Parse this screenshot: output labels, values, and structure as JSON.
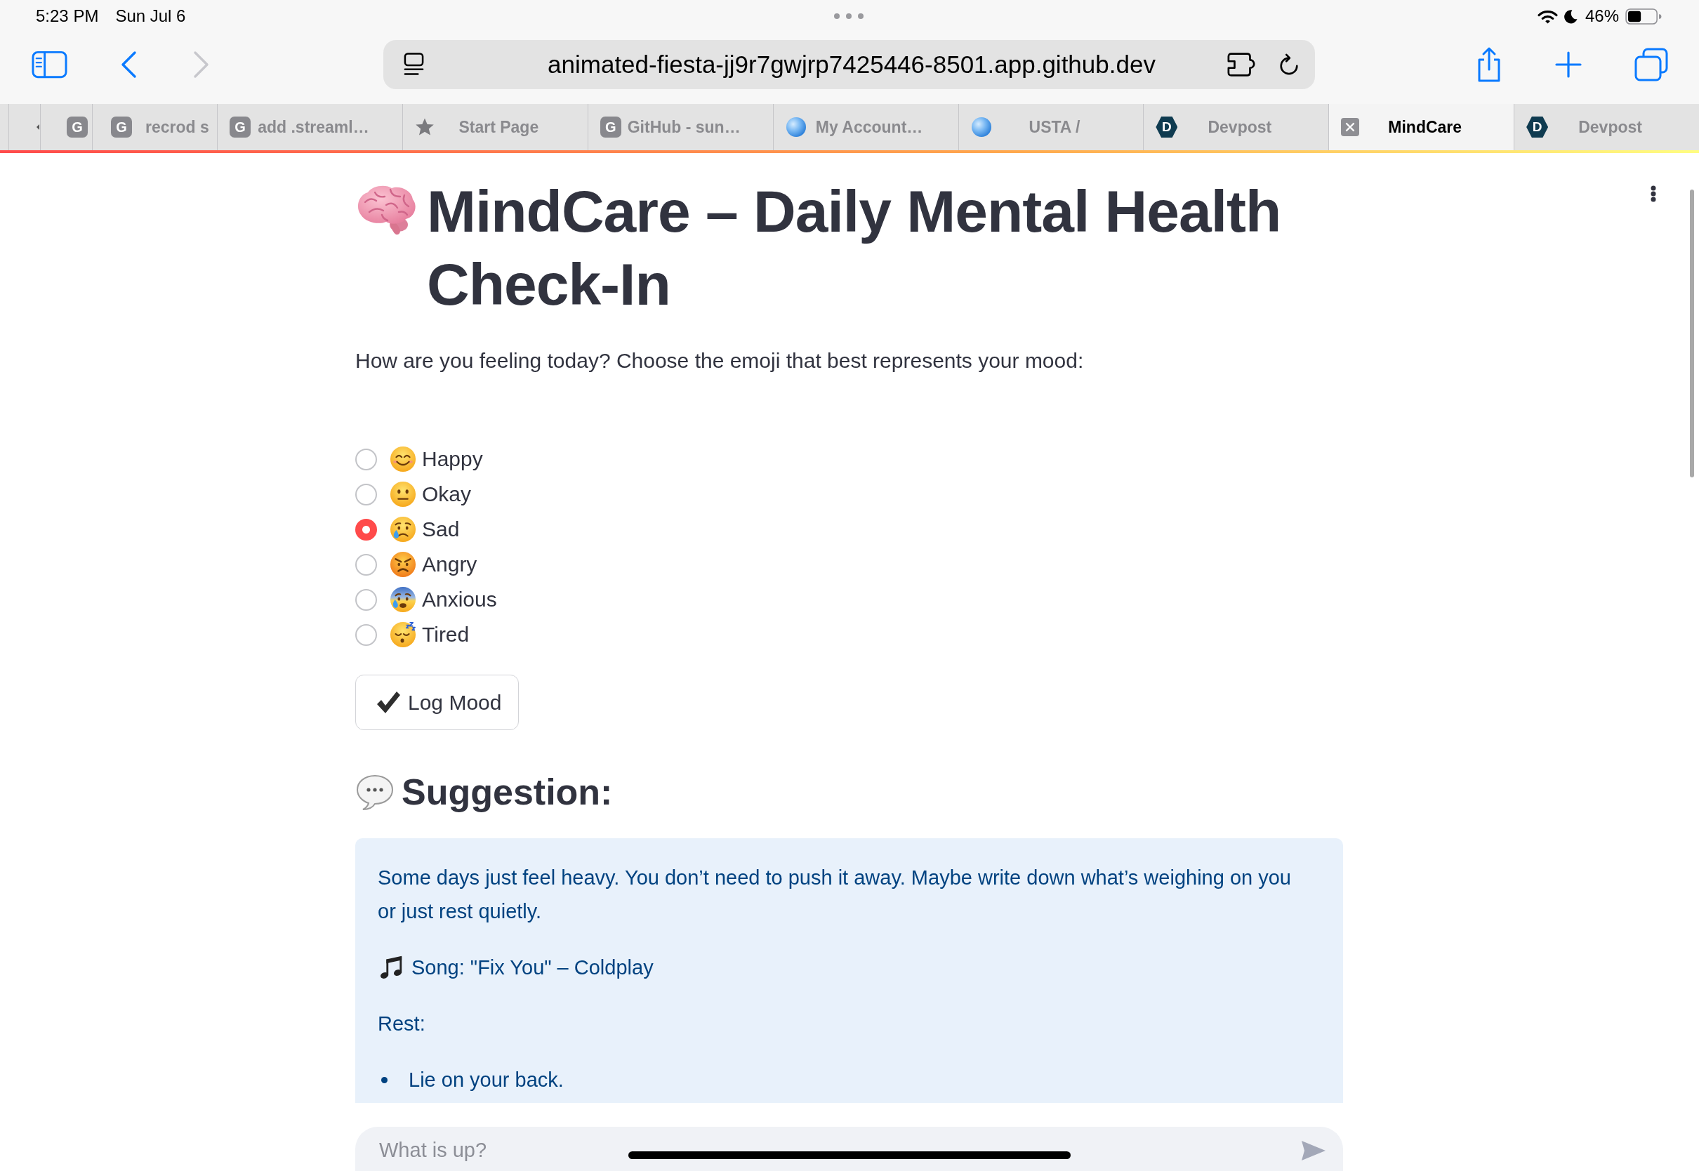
{
  "status_bar": {
    "time": "5:23 PM",
    "date": "Sun Jul 6",
    "battery": "46%"
  },
  "address_bar": {
    "url": "animated-fiesta-jj9r7gwjrp7425446-8501.app.github.dev"
  },
  "tabs": [
    {
      "kind": "sliver",
      "selected": false
    },
    {
      "kind": "letter",
      "icon_text": "G",
      "selected": false
    },
    {
      "kind": "letter",
      "icon_text": "G",
      "title": "recrod s",
      "selected": false
    },
    {
      "kind": "letter",
      "icon_text": "G",
      "title": "add .streaml…",
      "selected": false
    },
    {
      "kind": "star",
      "title": "Start Page",
      "selected": false
    },
    {
      "kind": "letter",
      "icon_text": "G",
      "title": "GitHub - sun…",
      "selected": false
    },
    {
      "kind": "sphere",
      "title": "My Account…",
      "selected": false
    },
    {
      "kind": "sphere",
      "title": "USTA /",
      "selected": false
    },
    {
      "kind": "hexagon",
      "icon_text": "D",
      "title": "Devpost",
      "selected": false
    },
    {
      "kind": "close",
      "title": "MindCare",
      "selected": true
    },
    {
      "kind": "hexagon",
      "icon_text": "D",
      "title": "Devpost",
      "selected": false
    }
  ],
  "app": {
    "title": "MindCare – Daily Mental Health Check-In",
    "prompt": "How are you feeling today? Choose the emoji that best represents your mood:",
    "moods": [
      {
        "kind": "smiling",
        "label": "Happy",
        "selected": false
      },
      {
        "kind": "neutral",
        "label": "Okay",
        "selected": false
      },
      {
        "kind": "crying",
        "label": "Sad",
        "selected": true
      },
      {
        "kind": "angry",
        "label": "Angry",
        "selected": false
      },
      {
        "kind": "anxious",
        "label": "Anxious",
        "selected": false
      },
      {
        "kind": "sleeping",
        "label": "Tired",
        "selected": false
      }
    ],
    "log_button": "Log Mood",
    "suggestion_heading": "Suggestion:",
    "suggestion": {
      "message": "Some days just feel heavy. You don’t need to push it away. Maybe write down what’s weighing on you or just rest quietly.",
      "song": "Song: \"Fix You\" – Coldplay",
      "rest_label": "Rest:",
      "rest_steps": [
        "Lie on your back."
      ]
    },
    "chat_input": {
      "placeholder": "What is up?"
    }
  }
}
